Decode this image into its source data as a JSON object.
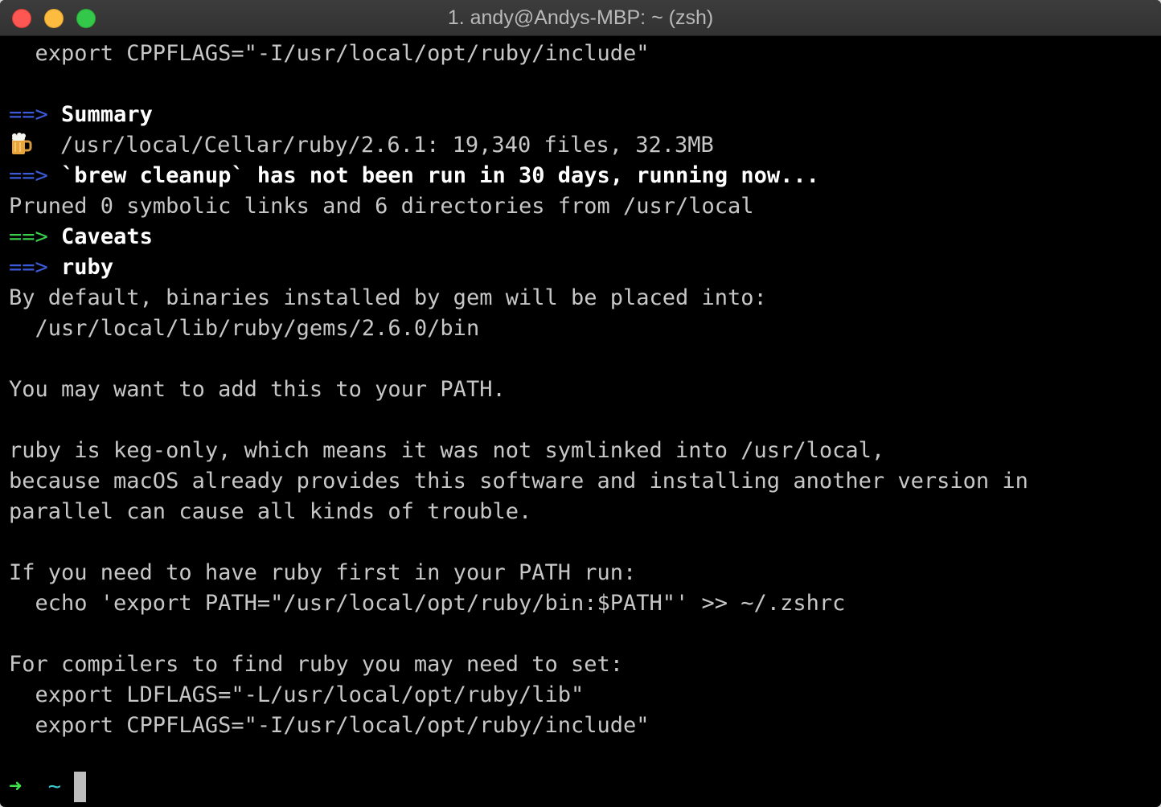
{
  "window": {
    "title": "1. andy@Andys-MBP: ~ (zsh)"
  },
  "colors": {
    "background": "#000000",
    "text": "#c7c7c7",
    "arrow_blue": "#3b5bdb",
    "arrow_green": "#3bcf4b",
    "prompt_arrow": "#3ee34a",
    "prompt_tilde": "#3ac8cf"
  },
  "terminal": {
    "line_export_cppflags_top": "  export CPPFLAGS=\"-I/usr/local/opt/ruby/include\"",
    "summary_arrow": "==>",
    "summary_label": "Summary",
    "beer_icon": "beer-mug-icon",
    "cellar_info": "/usr/local/Cellar/ruby/2.6.1: 19,340 files, 32.3MB",
    "cleanup_arrow": "==>",
    "cleanup_label": "`brew cleanup` has not been run in 30 days, running now...",
    "pruned": "Pruned 0 symbolic links and 6 directories from /usr/local",
    "caveats_arrow": "==>",
    "caveats_label": "Caveats",
    "ruby_arrow": "==>",
    "ruby_label": "ruby",
    "default_binaries": "By default, binaries installed by gem will be placed into:",
    "gems_path": "  /usr/local/lib/ruby/gems/2.6.0/bin",
    "add_to_path": "You may want to add this to your PATH.",
    "keg_only_1": "ruby is keg-only, which means it was not symlinked into /usr/local,",
    "keg_only_2": "because macOS already provides this software and installing another version in",
    "keg_only_3": "parallel can cause all kinds of trouble.",
    "first_in_path": "If you need to have ruby first in your PATH run:",
    "echo_command": "  echo 'export PATH=\"/usr/local/opt/ruby/bin:$PATH\"' >> ~/.zshrc",
    "compilers": "For compilers to find ruby you may need to set:",
    "ldflags": "  export LDFLAGS=\"-L/usr/local/opt/ruby/lib\"",
    "cppflags": "  export CPPFLAGS=\"-I/usr/local/opt/ruby/include\"",
    "prompt_arrow": "➜",
    "prompt_dir": "~"
  }
}
